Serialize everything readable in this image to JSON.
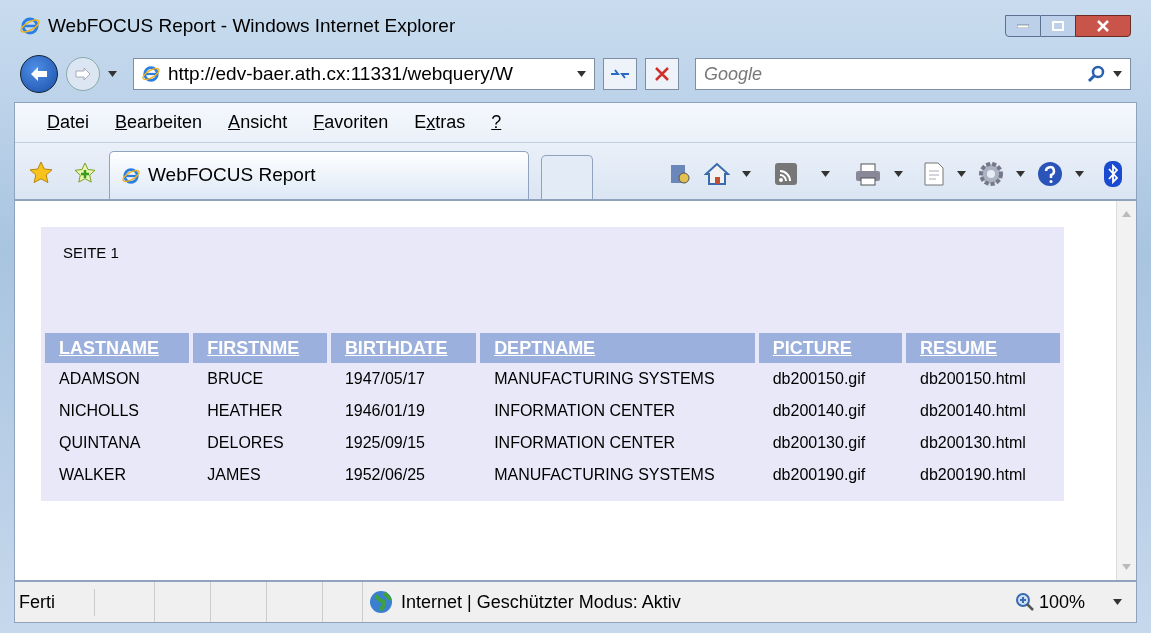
{
  "window": {
    "title": "WebFOCUS Report - Windows Internet Explorer"
  },
  "address": {
    "value": "http://edv-baer.ath.cx:11331/webquery/W"
  },
  "search": {
    "placeholder": "Google"
  },
  "menu": [
    {
      "key": "D",
      "post": "atei"
    },
    {
      "key": "B",
      "post": "earbeiten"
    },
    {
      "key": "A",
      "post": "nsicht"
    },
    {
      "key": "F",
      "post": "avoriten"
    },
    {
      "pre": "E",
      "key": "x",
      "post": "tras"
    },
    {
      "key": "?"
    }
  ],
  "tabs": [
    {
      "label": "WebFOCUS Report",
      "selected": true
    }
  ],
  "report": {
    "page": "SEITE 1",
    "columns": [
      "LASTNAME",
      "FIRSTNME",
      "BIRTHDATE",
      "DEPTNAME",
      "PICTURE",
      "RESUME"
    ],
    "rows": [
      [
        "ADAMSON",
        "BRUCE",
        "1947/05/17",
        "MANUFACTURING SYSTEMS",
        "db200150.gif",
        "db200150.html"
      ],
      [
        "NICHOLLS",
        "HEATHER",
        "1946/01/19",
        "INFORMATION CENTER",
        "db200140.gif",
        "db200140.html"
      ],
      [
        "QUINTANA",
        "DELORES",
        "1925/09/15",
        "INFORMATION CENTER",
        "db200130.gif",
        "db200130.html"
      ],
      [
        "WALKER",
        "JAMES",
        "1952/06/25",
        "MANUFACTURING SYSTEMS",
        "db200190.gif",
        "db200190.html"
      ]
    ]
  },
  "status_bar": {
    "text": "Ferti",
    "zone": "Internet | Geschützter Modus: Aktiv",
    "zoom": "100%"
  }
}
